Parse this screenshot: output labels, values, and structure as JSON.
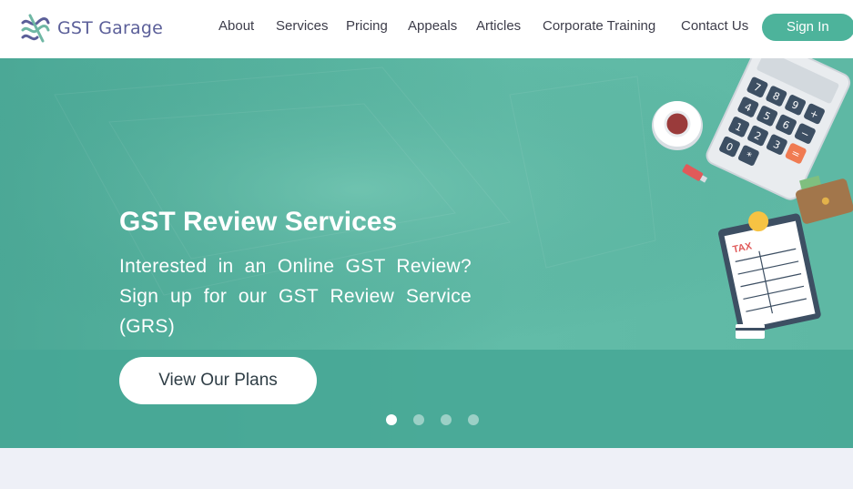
{
  "header": {
    "logo_text": "GST Garage",
    "nav": [
      {
        "label": "About"
      },
      {
        "label": "Services"
      },
      {
        "label": "Pricing"
      },
      {
        "label": "Appeals"
      },
      {
        "label": "Articles"
      },
      {
        "label": "Corporate Training"
      },
      {
        "label": "Contact Us"
      }
    ],
    "signin_label": "Sign In"
  },
  "hero": {
    "title": "GST Review Services",
    "subtitle": "Interested in an Online GST Review? Sign up for our GST Review Service (GRS)",
    "cta_label": "View Our Plans",
    "slides_total": 4,
    "active_slide": 1,
    "illustration": {
      "calculator_keys": [
        "7",
        "8",
        "9",
        "+",
        "4",
        "5",
        "6",
        "−",
        "1",
        "2",
        "3",
        "=",
        "0",
        "*"
      ],
      "clipboard_label": "TAX"
    }
  },
  "colors": {
    "brand_green": "#4db39b",
    "logo_purple": "#5b5f99",
    "hero_green": "#58b4a0",
    "page_bg": "#eef0f7"
  }
}
